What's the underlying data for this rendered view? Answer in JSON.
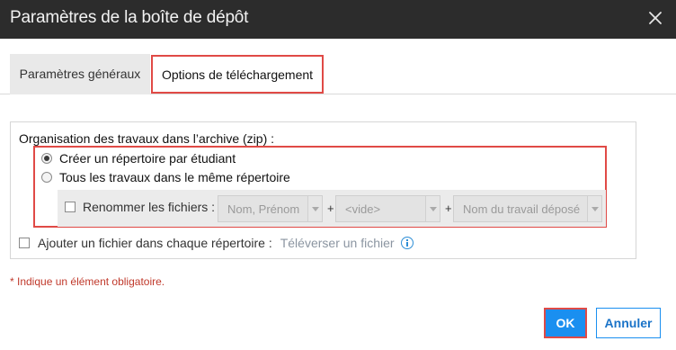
{
  "dialog": {
    "title": "Paramètres de la boîte de dépôt"
  },
  "tabs": [
    {
      "label": "Paramètres généraux"
    },
    {
      "label": "Options de téléchargement"
    }
  ],
  "organisation": {
    "title": "Organisation des travaux dans l’archive (zip) :",
    "options": [
      {
        "label": "Créer un répertoire par étudiant",
        "selected": true
      },
      {
        "label": "Tous les travaux dans le même répertoire",
        "selected": false
      }
    ],
    "rename": {
      "label": "Renommer les fichiers :",
      "checked": false,
      "select1": "Nom, Prénom",
      "plus1": "+",
      "select2": "<vide>",
      "plus2": "+",
      "select3": "Nom du travail déposé"
    },
    "attach": {
      "label": "Ajouter un fichier dans chaque répertoire :",
      "checked": false,
      "link": "Téléverser un fichier"
    }
  },
  "required_note": "* Indique un élément obligatoire.",
  "buttons": {
    "ok": "OK",
    "cancel": "Annuler"
  },
  "colors": {
    "titlebar": "#2c2c2c",
    "highlight": "#e04a46",
    "primary": "#1a8ff0",
    "required": "#c0392b"
  }
}
